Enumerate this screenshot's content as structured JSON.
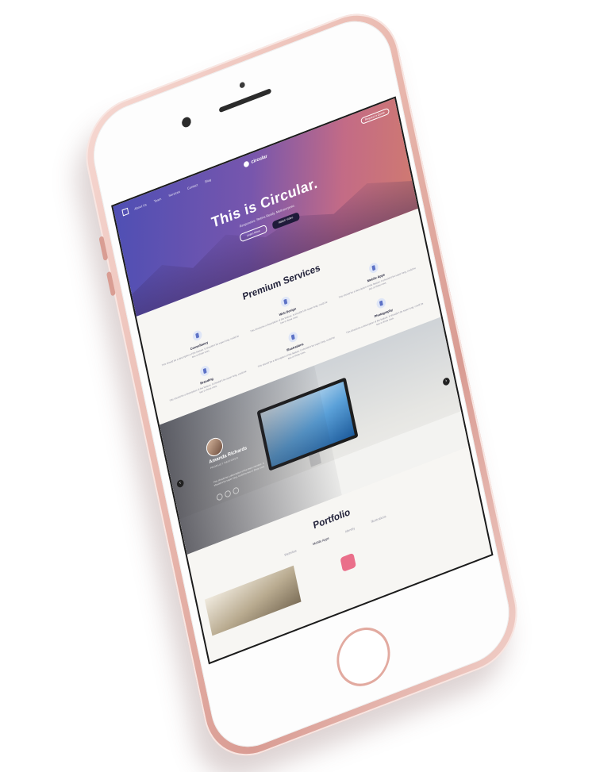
{
  "nav": {
    "links": [
      "About Us",
      "Team",
      "Services",
      "Contact",
      "Blog"
    ],
    "logo": "circular",
    "cta": "Request a Quote"
  },
  "hero": {
    "title": "This is Circular.",
    "subtitle": "Responsive. Retina Ready. Multi-purpose.",
    "btn_primary": "Learn More",
    "btn_secondary": "Watch Video"
  },
  "services": {
    "heading": "Premium Services",
    "items": [
      {
        "name": "Consultancy",
        "desc": "This should be a description of the feature. It shouldn't be super long, could be two or three rows."
      },
      {
        "name": "Web Design",
        "desc": "This should be a description of the feature. It shouldn't be super long, could be two or three rows."
      },
      {
        "name": "Mobile Apps",
        "desc": "This should be a description of the feature. It shouldn't be super long, could be two or three rows."
      },
      {
        "name": "Branding",
        "desc": "This should be a description of the feature. It shouldn't be super long, could be two or three rows."
      },
      {
        "name": "Illustrations",
        "desc": "This should be a description of the feature. It shouldn't be super long, could be two or three rows."
      },
      {
        "name": "Photography",
        "desc": "This should be a description of the feature. It shouldn't be super long, could be two or three rows."
      }
    ]
  },
  "team": {
    "name": "Amanda Richards",
    "role": "PRODUCT DESIGNER",
    "bio": "This should be a description of the team member. It shouldn't be super long, could be two or three rows.",
    "prev": "‹",
    "next": "›"
  },
  "portfolio": {
    "heading": "Portfolio",
    "tabs": [
      "Websites",
      "Mobile Apps",
      "Identity",
      "Illustrations"
    ]
  },
  "colors": {
    "hero_start": "#4f4fb4",
    "hero_end": "#d07a70",
    "phone_body": "#e9b8ae",
    "accent_pink": "#ea6f8a"
  }
}
